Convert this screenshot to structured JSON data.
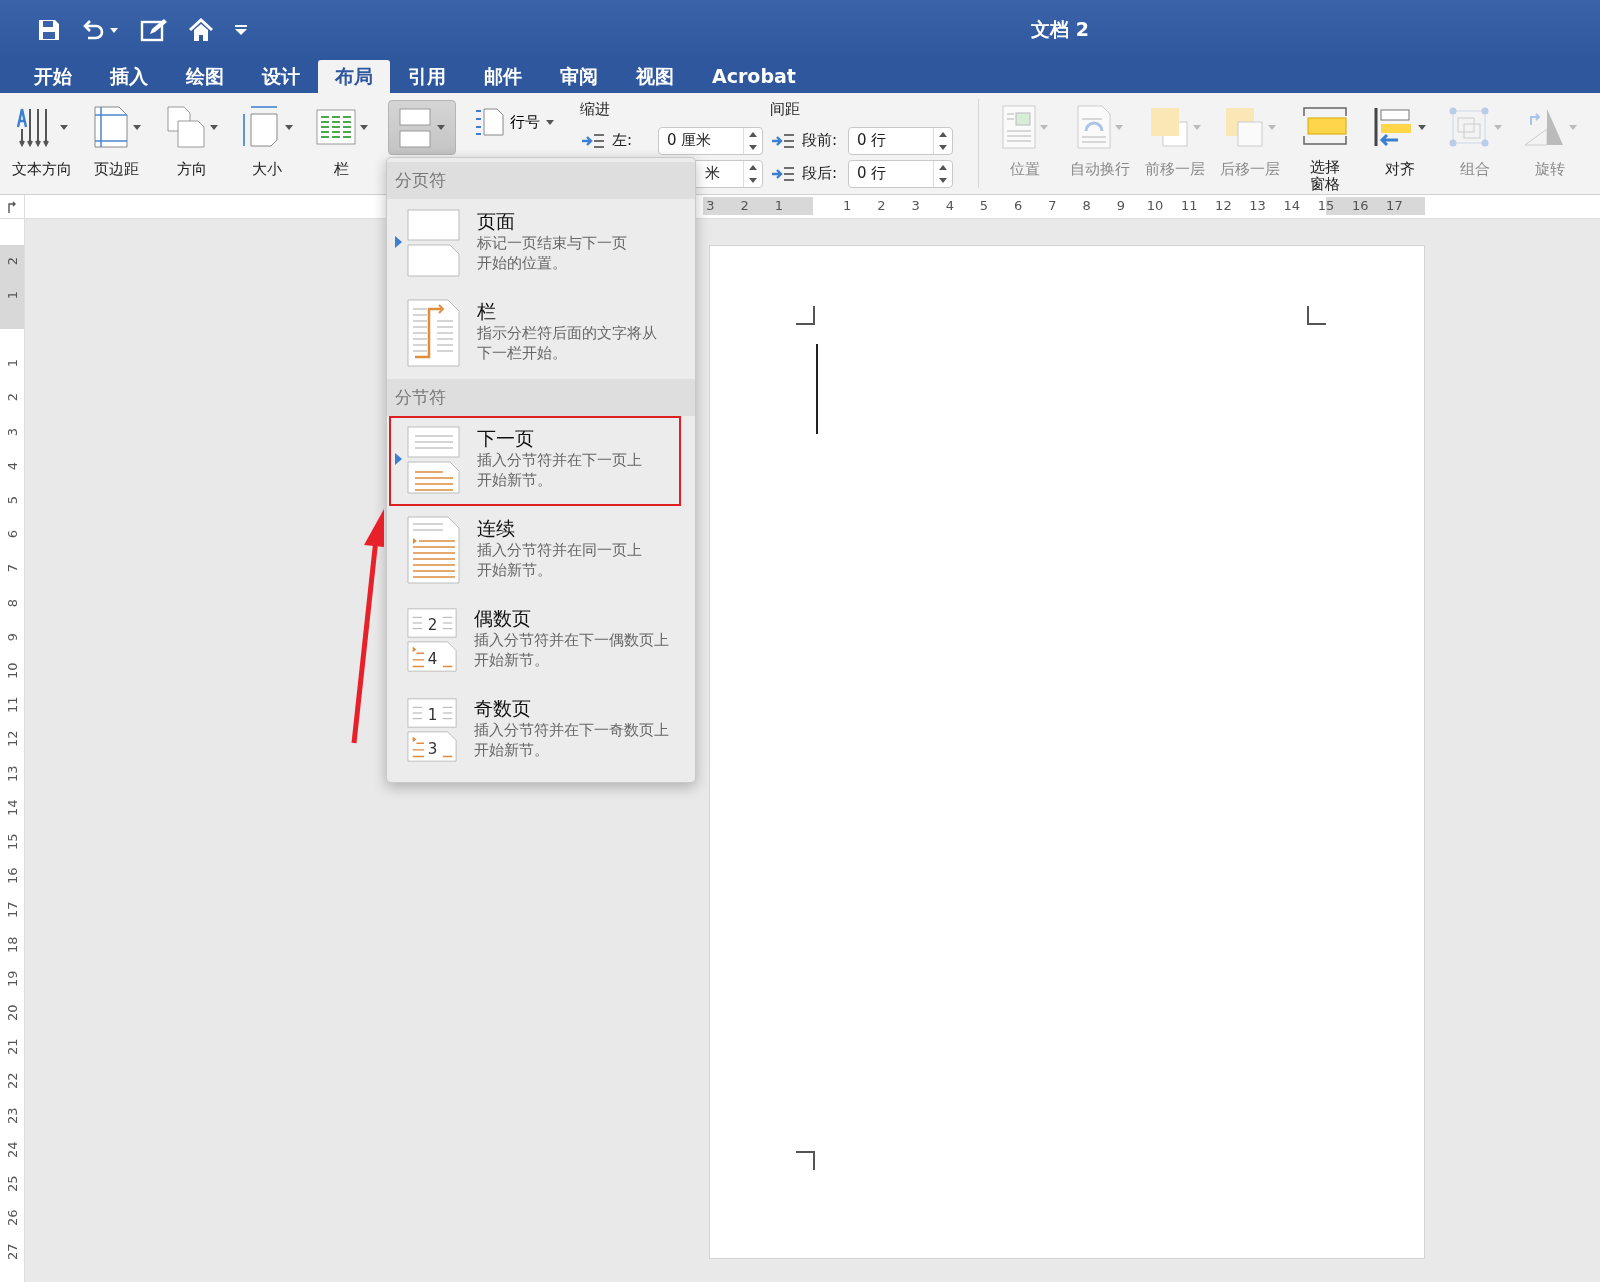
{
  "title_bar": {
    "title": "文档 2"
  },
  "tabs": [
    {
      "label": "开始",
      "selected": false
    },
    {
      "label": "插入",
      "selected": false
    },
    {
      "label": "绘图",
      "selected": false
    },
    {
      "label": "设计",
      "selected": false
    },
    {
      "label": "布局",
      "selected": true
    },
    {
      "label": "引用",
      "selected": false
    },
    {
      "label": "邮件",
      "selected": false
    },
    {
      "label": "审阅",
      "selected": false
    },
    {
      "label": "视图",
      "selected": false
    },
    {
      "label": "Acrobat",
      "selected": false
    }
  ],
  "ribbon": {
    "page_setup": [
      {
        "label": "文本方向",
        "kind": "text-direction",
        "dropdown": true,
        "disabled": false
      },
      {
        "label": "页边距",
        "kind": "margins",
        "dropdown": true,
        "disabled": false
      },
      {
        "label": "方向",
        "kind": "orientation",
        "dropdown": true,
        "disabled": false
      },
      {
        "label": "大小",
        "kind": "size",
        "dropdown": true,
        "disabled": false
      },
      {
        "label": "栏",
        "kind": "columns",
        "dropdown": true,
        "disabled": false
      }
    ],
    "breaks_button": {
      "pressed": true
    },
    "line_numbers": {
      "label": "行号"
    },
    "indent": {
      "title": "缩进",
      "rows": [
        {
          "label": "左:",
          "value": "0 厘米"
        },
        {
          "value": "米"
        }
      ]
    },
    "spacing": {
      "title": "间距",
      "rows": [
        {
          "label": "段前:",
          "value": "0 行"
        },
        {
          "label": "段后:",
          "value": "0 行"
        }
      ]
    },
    "arrange": [
      {
        "label": "位置",
        "kind": "position",
        "dropdown": true,
        "disabled": true
      },
      {
        "label": "自动换行",
        "kind": "wrap",
        "dropdown": true,
        "disabled": true
      },
      {
        "label": "前移一层",
        "kind": "forward",
        "dropdown": true,
        "disabled": true
      },
      {
        "label": "后移一层",
        "kind": "backward",
        "dropdown": true,
        "disabled": true
      },
      {
        "label": "选择窗格",
        "kind": "pane",
        "dropdown": false,
        "disabled": false
      },
      {
        "label": "对齐",
        "kind": "align",
        "dropdown": true,
        "disabled": false
      },
      {
        "label": "组合",
        "kind": "group",
        "dropdown": true,
        "disabled": true
      },
      {
        "label": "旋转",
        "kind": "rotate",
        "dropdown": true,
        "disabled": true
      }
    ]
  },
  "ruler": {
    "horizontal": [
      "3",
      "2",
      "1",
      "1",
      "2",
      "3",
      "4",
      "5",
      "6",
      "7",
      "8",
      "9",
      "10",
      "11",
      "12",
      "13",
      "14",
      "15",
      "16",
      "17"
    ],
    "vertical": [
      "2",
      "1",
      "1",
      "2",
      "3",
      "4",
      "5",
      "6",
      "7",
      "8",
      "9",
      "10",
      "11",
      "12",
      "13",
      "14",
      "15",
      "16",
      "17",
      "18",
      "19",
      "20",
      "21",
      "22",
      "23",
      "24",
      "25",
      "26",
      "27"
    ]
  },
  "breaks_menu": {
    "sections": [
      {
        "title": "分页符",
        "items": [
          {
            "title": "页面",
            "description": [
              "标记一页结束与下一页",
              "开始的位置。"
            ],
            "kind": "page",
            "selected": true,
            "highlighted": false
          },
          {
            "title": "栏",
            "description": [
              "指示分栏符后面的文字将从",
              "下一栏开始。"
            ],
            "kind": "column",
            "selected": false,
            "highlighted": false
          }
        ]
      },
      {
        "title": "分节符",
        "items": [
          {
            "title": "下一页",
            "description": [
              "插入分节符并在下一页上",
              "开始新节。"
            ],
            "kind": "next-page",
            "selected": true,
            "highlighted": true
          },
          {
            "title": "连续",
            "description": [
              "插入分节符并在同一页上",
              "开始新节。"
            ],
            "kind": "continuous",
            "selected": false,
            "highlighted": false
          },
          {
            "title": "偶数页",
            "description": [
              "插入分节符并在下一偶数页上",
              "开始新节。"
            ],
            "kind": "even",
            "icon_numbers": [
              "2",
              "4"
            ],
            "selected": false,
            "highlighted": false
          },
          {
            "title": "奇数页",
            "description": [
              "插入分节符并在下一奇数页上",
              "开始新节。"
            ],
            "kind": "odd",
            "icon_numbers": [
              "1",
              "3"
            ],
            "selected": false,
            "highlighted": false
          }
        ]
      }
    ]
  }
}
